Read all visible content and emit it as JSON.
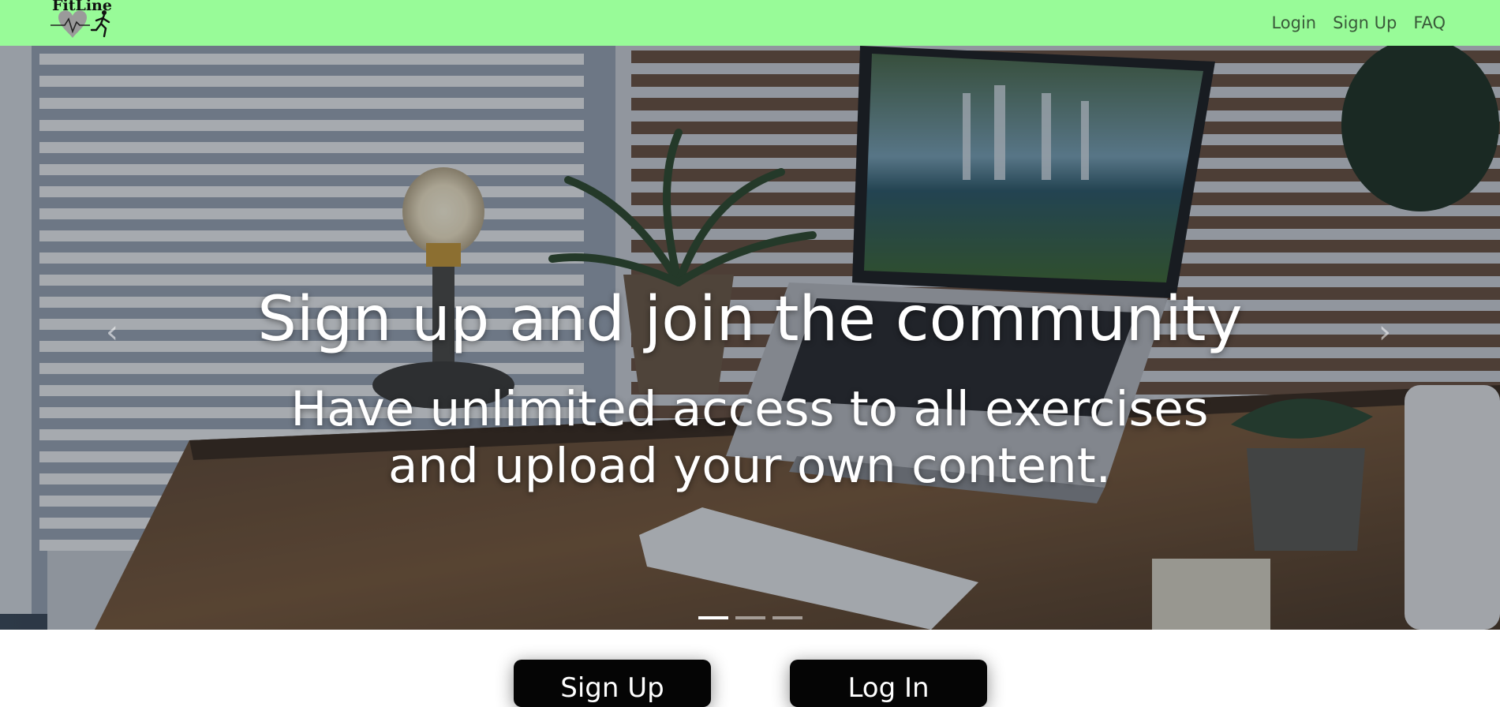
{
  "navbar": {
    "brand": "FitLine",
    "background": "#98fb98",
    "links": [
      "Login",
      "Sign Up",
      "FAQ"
    ]
  },
  "hero": {
    "title": "Sign up and join the community",
    "subtitle": "Have unlimited access to all exercises and upload your own content.",
    "prev_icon": "chevron-left-icon",
    "next_icon": "chevron-right-icon",
    "slides": 3,
    "active_slide": 1
  },
  "actions": {
    "signup_label": "Sign Up",
    "login_label": "Log In"
  }
}
